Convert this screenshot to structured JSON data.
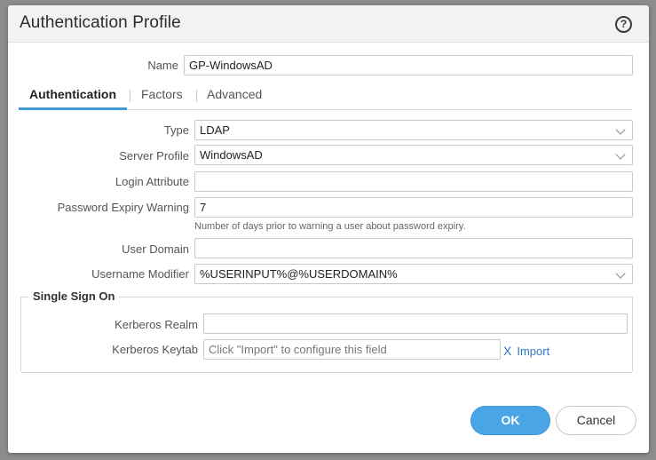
{
  "dialog": {
    "title": "Authentication Profile",
    "help_symbol": "?"
  },
  "name_row": {
    "label": "Name",
    "value": "GP-WindowsAD"
  },
  "tabs": [
    {
      "label": "Authentication",
      "active": true
    },
    {
      "label": "Factors",
      "active": false
    },
    {
      "label": "Advanced",
      "active": false
    }
  ],
  "fields": {
    "type": {
      "label": "Type",
      "value": "LDAP"
    },
    "server_profile": {
      "label": "Server Profile",
      "value": "WindowsAD"
    },
    "login_attribute": {
      "label": "Login Attribute",
      "value": ""
    },
    "password_expiry": {
      "label": "Password Expiry Warning",
      "value": "7",
      "hint": "Number of days prior to warning a user about password expiry."
    },
    "user_domain": {
      "label": "User Domain",
      "value": ""
    },
    "username_modifier": {
      "label": "Username Modifier",
      "value": "%USERINPUT%@%USERDOMAIN%"
    }
  },
  "sso": {
    "legend": "Single Sign On",
    "kerberos_realm": {
      "label": "Kerberos Realm",
      "value": ""
    },
    "kerberos_keytab": {
      "label": "Kerberos Keytab",
      "placeholder": "Click \"Import\" to configure this field"
    },
    "clear_symbol": "X",
    "import_label": "Import"
  },
  "buttons": {
    "ok": "OK",
    "cancel": "Cancel"
  },
  "colors": {
    "accent": "#4aa5e6",
    "tab_underline": "#3d9ad6",
    "link": "#2a77c8",
    "titlebar_bg": "#f2f2f2",
    "backdrop": "#8d8d8d"
  },
  "icons": {
    "help": "help-circle-icon",
    "dropdown": "chevron-down-icon",
    "clear": "clear-x-icon"
  }
}
